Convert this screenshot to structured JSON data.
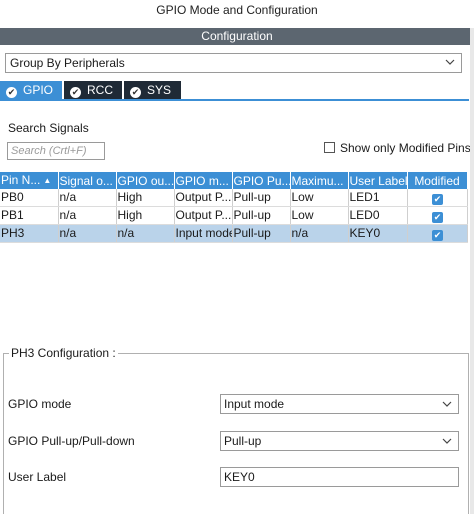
{
  "window": {
    "title": "GPIO Mode and Configuration"
  },
  "config_bar": {
    "label": "Configuration"
  },
  "group_select": {
    "value": "Group By Peripherals"
  },
  "tabs": [
    {
      "label": "GPIO",
      "active": true
    },
    {
      "label": "RCC",
      "active": false
    },
    {
      "label": "SYS",
      "active": false
    }
  ],
  "search": {
    "label": "Search Signals",
    "placeholder": "Search (Crtl+F)"
  },
  "filter": {
    "label": "Show only Modified Pins",
    "checked": false
  },
  "table": {
    "columns": [
      "Pin N...",
      "Signal o...",
      "GPIO ou...",
      "GPIO m...",
      "GPIO Pu...",
      "Maximu...",
      "User Label",
      "Modified"
    ],
    "rows": [
      {
        "pin": "PB0",
        "signal": "n/a",
        "output": "High",
        "mode": "Output P...",
        "pull": "Pull-up",
        "speed": "Low",
        "label": "LED1",
        "modified": true
      },
      {
        "pin": "PB1",
        "signal": "n/a",
        "output": "High",
        "mode": "Output P...",
        "pull": "Pull-up",
        "speed": "Low",
        "label": "LED0",
        "modified": true
      },
      {
        "pin": "PH3",
        "signal": "n/a",
        "output": "n/a",
        "mode": "Input mode",
        "pull": "Pull-up",
        "speed": "n/a",
        "label": "KEY0",
        "modified": true
      }
    ]
  },
  "pin_config": {
    "title": "PH3 Configuration :",
    "gpio_mode": {
      "label": "GPIO mode",
      "value": "Input mode"
    },
    "pull": {
      "label": "GPIO Pull-up/Pull-down",
      "value": "Pull-up"
    },
    "user_label": {
      "label": "User Label",
      "value": "KEY0"
    }
  },
  "colors": {
    "accent": "#3c8fd5",
    "header_bar": "#5c6670",
    "tab_inactive": "#1f2a36",
    "selected_row": "#bad3ea"
  }
}
